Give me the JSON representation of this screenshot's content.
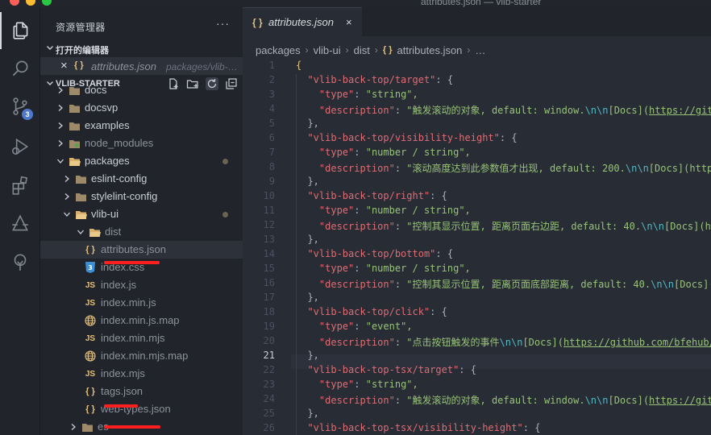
{
  "window": {
    "title": "attributes.json — vlib-starter"
  },
  "explorer": {
    "title": "资源管理器",
    "more": "···",
    "open_editors": {
      "label": "打开的编辑器",
      "file": "attributes.json",
      "path": "packages/vlib-…"
    },
    "project": {
      "label": "VLIB-STARTER"
    },
    "tree": [
      {
        "name": "docs",
        "icon": "folder"
      },
      {
        "name": "docsvp",
        "icon": "folder"
      },
      {
        "name": "examples",
        "icon": "folder"
      },
      {
        "name": "node_modules",
        "icon": "folder-node"
      },
      {
        "name": "packages",
        "icon": "folder-open"
      },
      {
        "name": "eslint-config",
        "icon": "folder"
      },
      {
        "name": "stylelint-config",
        "icon": "folder"
      },
      {
        "name": "vlib-ui",
        "icon": "folder-open"
      },
      {
        "name": "dist",
        "icon": "folder-open"
      },
      {
        "name": "attributes.json",
        "icon": "{ }"
      },
      {
        "name": "index.css",
        "icon": "3"
      },
      {
        "name": "index.js",
        "icon": "JS"
      },
      {
        "name": "index.min.js",
        "icon": "JS"
      },
      {
        "name": "index.min.js.map",
        "icon": "globe"
      },
      {
        "name": "index.min.mjs",
        "icon": "JS"
      },
      {
        "name": "index.min.mjs.map",
        "icon": "globe"
      },
      {
        "name": "index.mjs",
        "icon": "JS"
      },
      {
        "name": "tags.json",
        "icon": "{ }"
      },
      {
        "name": "web-types.json",
        "icon": "{ }"
      },
      {
        "name": "es",
        "icon": "folder"
      }
    ]
  },
  "activity": {
    "scm_badge": "3"
  },
  "editor": {
    "tab": {
      "icon": "{ }",
      "label": "attributes.json",
      "close": "×"
    },
    "breadcrumb": [
      "packages",
      "vlib-ui",
      "dist",
      "attributes.json",
      "…"
    ],
    "breadcrumb_icon": "{ }",
    "current_line": 21,
    "lines": [
      {
        "n": "1",
        "t": "{"
      },
      {
        "n": "2",
        "t": "  \"vlib-back-top/target\": {"
      },
      {
        "n": "3",
        "t": "    \"type\": \"string\","
      },
      {
        "n": "4",
        "t": "    \"description\": \"触发滚动的对象, default: window.\\n\\n[Docs](https://git"
      },
      {
        "n": "5",
        "t": "  },"
      },
      {
        "n": "6",
        "t": "  \"vlib-back-top/visibility-height\": {"
      },
      {
        "n": "7",
        "t": "    \"type\": \"number / string\","
      },
      {
        "n": "8",
        "t": "    \"description\": \"滚动高度达到此参数值才出现, default: 200.\\n\\n[Docs](http"
      },
      {
        "n": "9",
        "t": "  },"
      },
      {
        "n": "10",
        "t": "  \"vlib-back-top/right\": {"
      },
      {
        "n": "11",
        "t": "    \"type\": \"number / string\","
      },
      {
        "n": "12",
        "t": "    \"description\": \"控制其显示位置, 距离页面右边距, default: 40.\\n\\n[Docs](ht"
      },
      {
        "n": "13",
        "t": "  },"
      },
      {
        "n": "14",
        "t": "  \"vlib-back-top/bottom\": {"
      },
      {
        "n": "15",
        "t": "    \"type\": \"number / string\","
      },
      {
        "n": "16",
        "t": "    \"description\": \"控制其显示位置, 距离页面底部距离, default: 40.\\n\\n[Docs]("
      },
      {
        "n": "17",
        "t": "  },"
      },
      {
        "n": "18",
        "t": "  \"vlib-back-top/click\": {"
      },
      {
        "n": "19",
        "t": "    \"type\": \"event\","
      },
      {
        "n": "20",
        "t": "    \"description\": \"点击按钮触发的事件\\n\\n[Docs](https://github.com/bfehub/"
      },
      {
        "n": "21",
        "t": "  },"
      },
      {
        "n": "22",
        "t": "  \"vlib-back-top-tsx/target\": {"
      },
      {
        "n": "23",
        "t": "    \"type\": \"string\","
      },
      {
        "n": "24",
        "t": "    \"description\": \"触发滚动的对象, default: window.\\n\\n[Docs](https://git"
      },
      {
        "n": "25",
        "t": "  },"
      },
      {
        "n": "26",
        "t": "  \"vlib-back-top-tsx/visibility-height\": {"
      }
    ]
  },
  "colors": {
    "accent": "#4d78cc",
    "annotation": "#ff1f1f",
    "json_icon": "#e5c07b",
    "key": "#e06c75",
    "string": "#98c379"
  }
}
